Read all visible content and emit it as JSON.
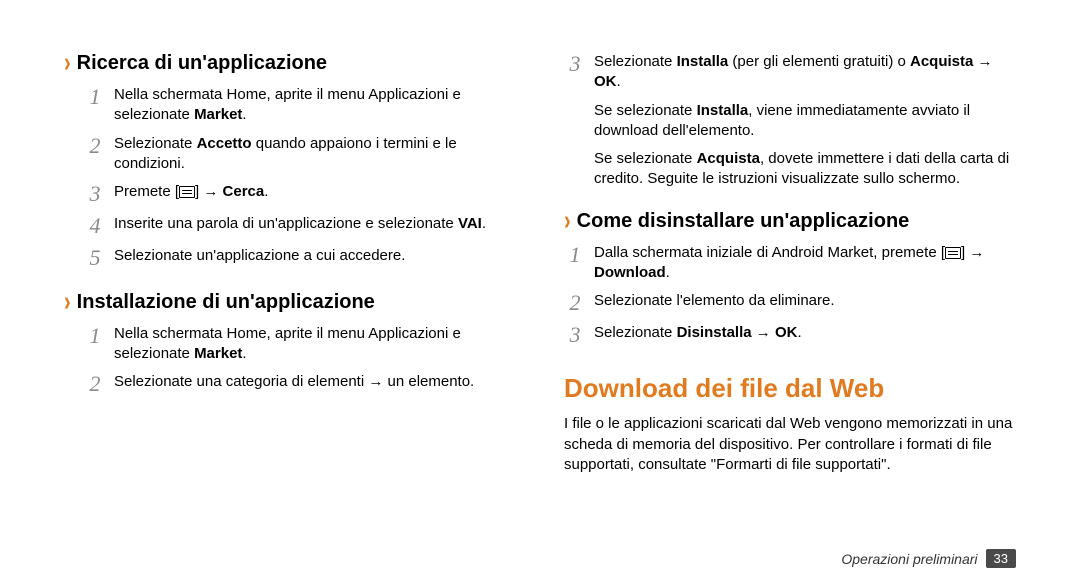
{
  "left": {
    "s1": {
      "title": "Ricerca di un'applicazione",
      "st1a": "Nella schermata Home, aprite il menu Applicazioni e selezionate ",
      "st1b": "Market",
      "st1c": ".",
      "st2a": "Selezionate ",
      "st2b": "Accetto",
      "st2c": " quando appaiono i termini e le condizioni.",
      "st3a": "Premete [",
      "st3b": "] → ",
      "st3c": "Cerca",
      "st3d": ".",
      "st4a": "Inserite una parola di un'applicazione e selezionate ",
      "st4b": "VAI",
      "st4c": ".",
      "st5": "Selezionate un'applicazione a cui accedere."
    },
    "s2": {
      "title": "Installazione di un'applicazione",
      "st1a": "Nella schermata Home, aprite il menu Applicazioni e selezionate ",
      "st1b": "Market",
      "st1c": ".",
      "st2": "Selezionate una categoria di elementi → un elemento."
    }
  },
  "right": {
    "cont": {
      "st3a": "Selezionate ",
      "st3b": "Installa",
      "st3c": " (per gli elementi gratuiti) o ",
      "st3d": "Acquista",
      "st3e": " → ",
      "st3f": "OK",
      "st3g": ".",
      "note1a": "Se selezionate ",
      "note1b": "Installa",
      "note1c": ", viene immediatamente avviato il download dell'elemento.",
      "note2a": "Se selezionate ",
      "note2b": "Acquista",
      "note2c": ", dovete immettere i dati della carta di credito. Seguite le istruzioni visualizzate sullo schermo."
    },
    "s3": {
      "title": "Come disinstallare un'applicazione",
      "st1a": "Dalla schermata iniziale di Android Market, premete [",
      "st1b": "] → ",
      "st1c": "Download",
      "st1d": ".",
      "st2": "Selezionate l'elemento da eliminare.",
      "st3a": "Selezionate ",
      "st3b": "Disinstalla",
      "st3c": " → ",
      "st3d": "OK",
      "st3e": "."
    },
    "h1": "Download dei file dal Web",
    "body": "I file o le applicazioni scaricati dal Web vengono memorizzati in una scheda di memoria del dispositivo. Per controllare i formati di file supportati, consultate \"Formarti di file supportati\"."
  },
  "footer": {
    "section": "Operazioni preliminari",
    "page": "33"
  },
  "nums": {
    "n1": "1",
    "n2": "2",
    "n3": "3",
    "n4": "4",
    "n5": "5"
  }
}
